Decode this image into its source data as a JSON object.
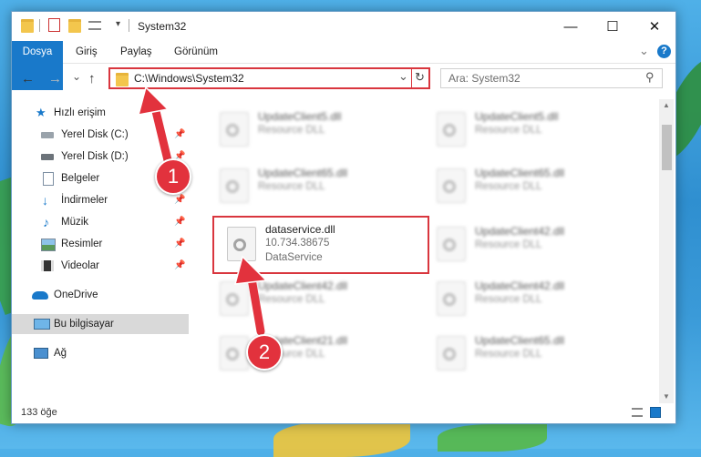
{
  "window": {
    "title": "System32",
    "controls": {
      "minimize": "—",
      "maximize": "☐",
      "close": "✕"
    }
  },
  "ribbon": {
    "tabs": [
      "Dosya",
      "Giriş",
      "Paylaş",
      "Görünüm"
    ],
    "expand_glyph": "⌄",
    "help": "?"
  },
  "navigation": {
    "back": "←",
    "forward": "→",
    "recent": "⌄",
    "up": "↑",
    "address": "C:\\Windows\\System32",
    "address_dropdown": "⌄",
    "refresh": "↻",
    "search_placeholder": "Ara: System32",
    "search_icon": "⚲"
  },
  "sidebar": {
    "quick_access": "Hızlı erişim",
    "items": [
      {
        "label": "Yerel Disk (C:)",
        "icon": "drive-icon",
        "pinned": true
      },
      {
        "label": "Yerel Disk (D:)",
        "icon": "drive-icon",
        "pinned": true
      },
      {
        "label": "Belgeler",
        "icon": "documents-icon",
        "pinned": true
      },
      {
        "label": "İndirmeler",
        "icon": "download-icon",
        "pinned": true
      },
      {
        "label": "Müzik",
        "icon": "music-icon",
        "pinned": true
      },
      {
        "label": "Resimler",
        "icon": "pictures-icon",
        "pinned": true
      },
      {
        "label": "Videolar",
        "icon": "video-icon",
        "pinned": true
      }
    ],
    "onedrive": "OneDrive",
    "this_pc": "Bu bilgisayar",
    "network": "Ağ",
    "pin_glyph": "📌"
  },
  "files": [
    {
      "name": "UpdateClient5.dll",
      "line2": "Resource DLL",
      "line3": "",
      "blurred": true
    },
    {
      "name": "UpdateClient5.dll",
      "line2": "Resource DLL",
      "line3": "",
      "blurred": true
    },
    {
      "name": "UpdateClient65.dll",
      "line2": "Resource DLL",
      "line3": "",
      "blurred": true
    },
    {
      "name": "UpdateClient65.dll",
      "line2": "Resource DLL",
      "line3": "",
      "blurred": true
    },
    {
      "name": "dataservice.dll",
      "line2": "10.734.38675",
      "line3": "DataService",
      "blurred": false
    },
    {
      "name": "UpdateClient42.dll",
      "line2": "Resource DLL",
      "line3": "",
      "blurred": true
    },
    {
      "name": "UpdateClient42.dll",
      "line2": "Resource DLL",
      "line3": "",
      "blurred": true
    },
    {
      "name": "UpdateClient42.dll",
      "line2": "Resource DLL",
      "line3": "",
      "blurred": true
    },
    {
      "name": "UpdateClient21.dll",
      "line2": "Resource DLL",
      "line3": "",
      "blurred": true
    },
    {
      "name": "UpdateClient65.dll",
      "line2": "Resource DLL",
      "line3": "",
      "blurred": true
    }
  ],
  "status": {
    "count": "133 öğe"
  },
  "annotations": {
    "badge1": "1",
    "badge2": "2"
  },
  "colors": {
    "accent": "#1979ca",
    "highlight": "#d9363e"
  }
}
